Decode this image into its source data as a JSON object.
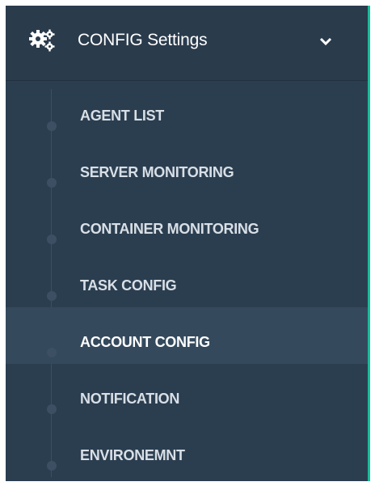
{
  "sidebar": {
    "menu": {
      "icon": "gears-icon",
      "title": "CONFIG Settings",
      "expand_icon": "chevron-down-icon",
      "expanded": true
    },
    "items": [
      {
        "label": "AGENT LIST",
        "active": false
      },
      {
        "label": "SERVER MONITORING",
        "active": false
      },
      {
        "label": "CONTAINER MONITORING",
        "active": false
      },
      {
        "label": "TASK CONFIG",
        "active": false
      },
      {
        "label": "ACCOUNT CONFIG",
        "active": true
      },
      {
        "label": "NOTIFICATION",
        "active": false
      },
      {
        "label": "ENVIRONEMNT",
        "active": false
      }
    ]
  },
  "colors": {
    "sidebar_bg": "#2b3e50",
    "active_item_bg": "#34495c",
    "accent": "#1abc9c",
    "text": "#ffffff"
  }
}
